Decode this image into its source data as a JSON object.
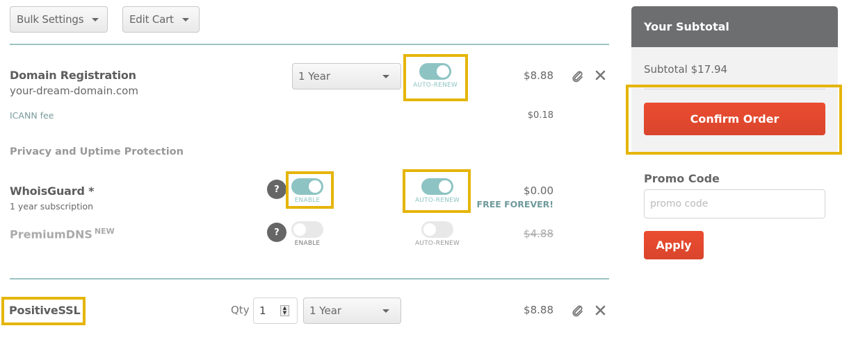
{
  "toolbar": {
    "bulk_settings_label": "Bulk Settings",
    "edit_cart_label": "Edit Cart"
  },
  "cart": {
    "domain": {
      "title": "Domain Registration",
      "domain_name": "your-dream-domain.com",
      "period": "1 Year",
      "auto_renew_label": "AUTO-RENEW",
      "auto_renew_on": true,
      "price": "$8.88",
      "icann_label": "ICANN fee",
      "icann_price": "$0.18"
    },
    "protection_heading": "Privacy and Uptime Protection",
    "whoisguard": {
      "title": "WhoisGuard *",
      "subtitle": "1 year subscription",
      "help": "?",
      "enable_label": "ENABLE",
      "enable_on": true,
      "auto_renew_label": "AUTO-RENEW",
      "auto_renew_on": true,
      "price": "$0.00",
      "promo": "FREE FOREVER!"
    },
    "premiumdns": {
      "title": "PremiumDNS",
      "badge": "NEW",
      "help": "?",
      "enable_label": "ENABLE",
      "enable_on": false,
      "auto_renew_label": "AUTO-RENEW",
      "auto_renew_on": false,
      "price": "$4.88"
    },
    "ssl": {
      "title": "PositiveSSL",
      "qty_label": "Qty",
      "qty_value": "1",
      "period": "1 Year",
      "price": "$8.88"
    }
  },
  "summary": {
    "heading": "Your Subtotal",
    "subtotal": "Subtotal $17.94",
    "confirm_label": "Confirm Order"
  },
  "promo": {
    "heading": "Promo Code",
    "placeholder": "promo code",
    "value": "",
    "apply_label": "Apply"
  },
  "colors": {
    "accent_teal": "#8ec3c3",
    "action_red": "#e84c30",
    "highlight": "#e5b50a"
  }
}
